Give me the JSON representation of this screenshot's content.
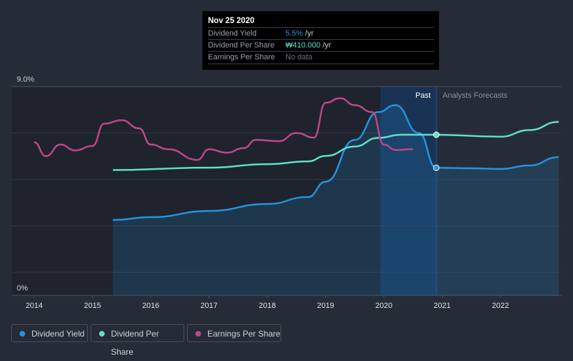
{
  "tooltip": {
    "date": "Nov 25 2020",
    "rows": [
      {
        "label": "Dividend Yield",
        "value": "5.5%",
        "unit": " /yr",
        "color": "#2394e0"
      },
      {
        "label": "Dividend Per Share",
        "value": "₩410.000",
        "unit": " /yr",
        "color": "#5ee0cc"
      },
      {
        "label": "Earnings Per Share",
        "value": "No data",
        "unit": "",
        "color": "#6d727a"
      }
    ]
  },
  "chart_data": {
    "type": "line",
    "y_ticks": [
      "9.0%",
      "0%"
    ],
    "ylim": [
      0,
      9
    ],
    "xlim": [
      2013.6,
      2023
    ],
    "x_ticks": [
      "2014",
      "2015",
      "2016",
      "2017",
      "2018",
      "2019",
      "2020",
      "2021",
      "2022"
    ],
    "past_label": "Past",
    "forecast_label": "Analysts Forecasts",
    "forecast_start": 2020.9,
    "series": [
      {
        "name": "Dividend Yield",
        "color": "#2394e0",
        "area": true,
        "x": [
          2015.35,
          2016,
          2017,
          2018,
          2018.7,
          2019,
          2019.5,
          2019.9,
          2020.2,
          2020.6,
          2020.9,
          2021.5,
          2022,
          2022.5,
          2023
        ],
        "y": [
          3.25,
          3.37,
          3.64,
          3.94,
          4.24,
          4.9,
          6.7,
          7.9,
          8.2,
          7.0,
          5.5,
          5.48,
          5.45,
          5.6,
          5.96
        ]
      },
      {
        "name": "Dividend Per Share",
        "color": "#5ee0cc",
        "x": [
          2015.35,
          2017,
          2018,
          2018.7,
          2019,
          2019.5,
          2019.9,
          2020.3,
          2020.9,
          2022,
          2022.5,
          2023
        ],
        "y": [
          320,
          326,
          335,
          342,
          356,
          380,
          402,
          410,
          410,
          405,
          422,
          443
        ],
        "ylim": [
          0,
          533
        ]
      },
      {
        "name": "Earnings Per Share",
        "color": "#c0468a",
        "x": [
          2014,
          2014.2,
          2014.45,
          2014.7,
          2015,
          2015.2,
          2015.5,
          2015.8,
          2016,
          2016.3,
          2016.8,
          2017,
          2017.3,
          2017.6,
          2017.8,
          2018.2,
          2018.5,
          2018.8,
          2019,
          2019.25,
          2019.5,
          2019.8,
          2020,
          2020.2,
          2020.5
        ],
        "y": [
          6.6,
          6.0,
          6.5,
          6.25,
          6.44,
          7.4,
          7.55,
          7.2,
          6.5,
          6.3,
          5.84,
          6.3,
          6.15,
          6.35,
          6.7,
          6.65,
          7.0,
          6.8,
          8.3,
          8.5,
          8.2,
          7.9,
          6.5,
          6.27,
          6.3
        ]
      }
    ]
  },
  "legend": [
    "Dividend Yield",
    "Dividend Per Share",
    "Earnings Per Share"
  ]
}
